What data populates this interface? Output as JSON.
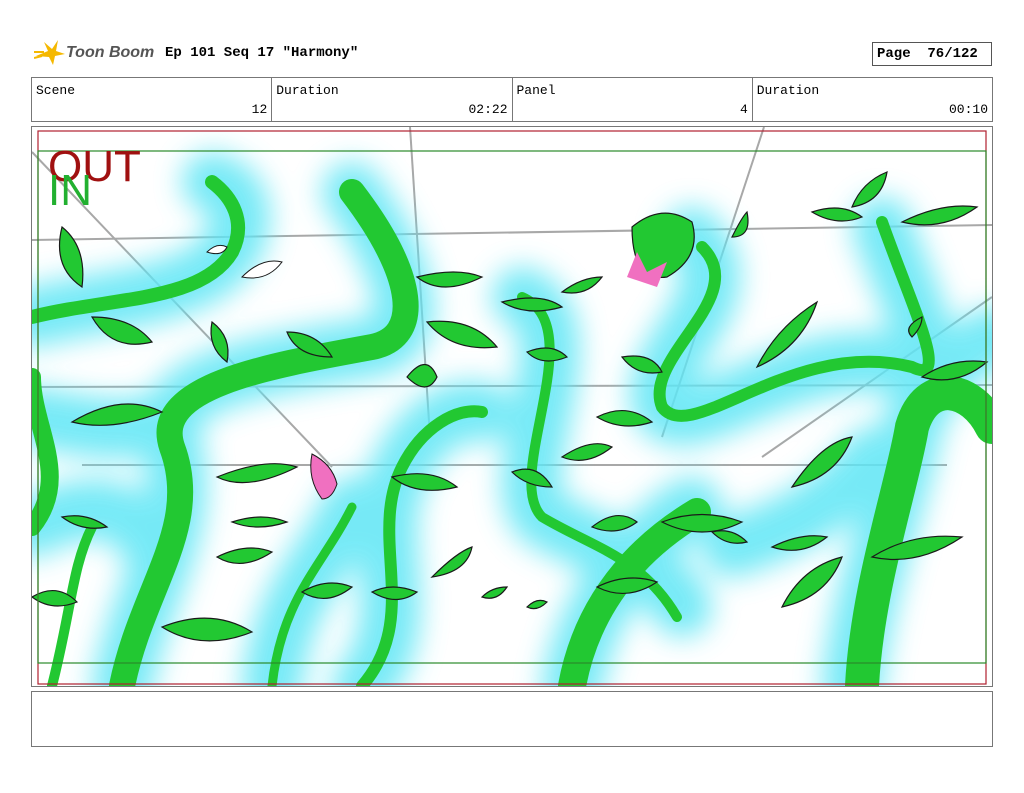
{
  "header": {
    "logo_text": "Toon Boom",
    "title": "Ep 101 Seq 17 \"Harmony\"",
    "page": "Page  76/122"
  },
  "info": [
    {
      "label": "Scene",
      "value": "12"
    },
    {
      "label": "Duration",
      "value": "02:22"
    },
    {
      "label": "Panel",
      "value": "4"
    },
    {
      "label": "Duration",
      "value": "00:10"
    }
  ],
  "panel": {
    "out_label": "OUT",
    "in_label": "IN"
  },
  "caption": {
    "text": ""
  },
  "colors": {
    "vine": "#22c832",
    "glow": "#5ee6f5",
    "out": "#a01010",
    "in": "#22b030",
    "bud": "#f070c0"
  }
}
